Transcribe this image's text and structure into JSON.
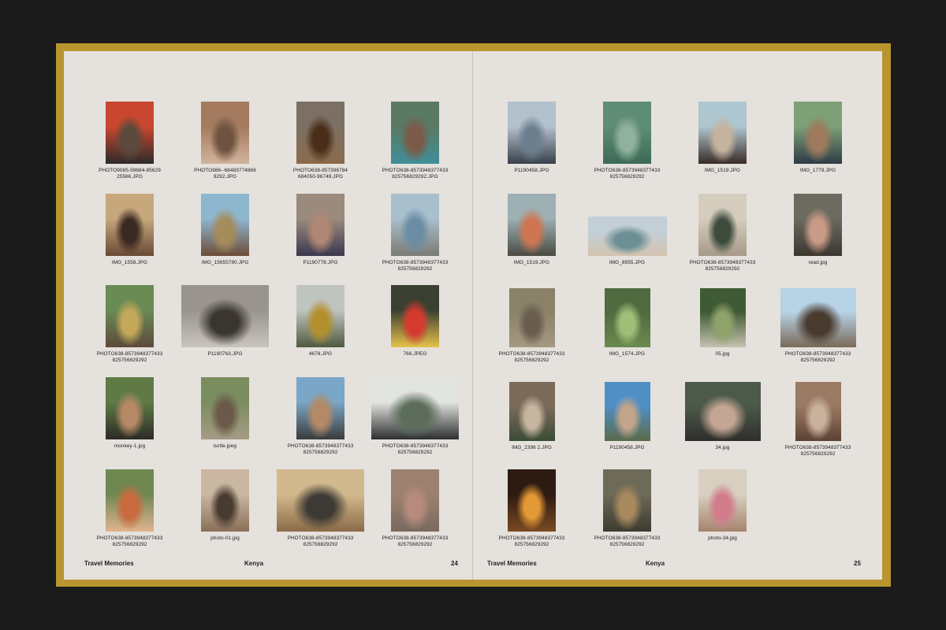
{
  "book": {
    "title": "Travel Memories"
  },
  "pages": [
    {
      "section": "Kenya",
      "number": "24",
      "photos": [
        {
          "caption": "PHOTO9085-59684-85629\n25566.JPG",
          "colors": [
            "#c9472e",
            "#5b4a3d",
            "#2c2b2a"
          ]
        },
        {
          "caption": "PHOTO986--68483774866\n9292.JPG",
          "colors": [
            "#a47b5e",
            "#6f533f",
            "#d1b39b"
          ]
        },
        {
          "caption": "PHOTO638-857396784\n684050-96749.JPG",
          "colors": [
            "#7b7063",
            "#4a2e1a",
            "#8c6a4a"
          ]
        },
        {
          "caption": "PHOTO638-8573948377433\n825756829292.JPG",
          "colors": [
            "#5a7a63",
            "#7a5b49",
            "#3f8f9b"
          ]
        },
        {
          "caption": "IMG_1558.JPG",
          "colors": [
            "#c7a77c",
            "#3b2a22",
            "#6a4a36"
          ]
        },
        {
          "caption": "IMG_15655780.JPG",
          "colors": [
            "#8db6cf",
            "#a68c5b",
            "#6e4b37"
          ]
        },
        {
          "caption": "P1190778.JPG",
          "colors": [
            "#9a8b7d",
            "#b08774",
            "#3a3850"
          ]
        },
        {
          "caption": "PHOTO638-8573948377433\n825756829292",
          "colors": [
            "#a9bfcc",
            "#6a8da3",
            "#7b7a73"
          ]
        },
        {
          "caption": "PHOTO638-8573948377433\n825756829292",
          "colors": [
            "#6a8b54",
            "#c6a85b",
            "#5c4a3c"
          ]
        },
        {
          "caption": "P1190763.JPG",
          "colors": [
            "#9a9490",
            "#3a3530",
            "#c9c4bd"
          ]
        },
        {
          "caption": "4678.JPG",
          "colors": [
            "#bfc4c0",
            "#b3902e",
            "#4e5a3e"
          ]
        },
        {
          "caption": "766.JPEG",
          "colors": [
            "#3a3f31",
            "#d53a2f",
            "#e6c24a"
          ]
        },
        {
          "caption": "monkey-1.jpg",
          "colors": [
            "#5f7a45",
            "#b68966",
            "#2c2a26"
          ]
        },
        {
          "caption": "turtle.jpeg",
          "colors": [
            "#7a8d5e",
            "#6b5a49",
            "#a69b86"
          ]
        },
        {
          "caption": "PHOTO638-8573948377433\n825756829292",
          "colors": [
            "#7aa6c8",
            "#b48a66",
            "#3a3b3a"
          ]
        },
        {
          "caption": "PHOTO638-8573948377433\n825756829292",
          "colors": [
            "#e2e4e1",
            "#5c6e5a",
            "#2d2f2f"
          ]
        },
        {
          "caption": "PHOTO638-8573948377433\n825756829292",
          "colors": [
            "#6f8850",
            "#c96a3f",
            "#e1b38f"
          ]
        },
        {
          "caption": "photo-01.jpg",
          "colors": [
            "#c9b7a1",
            "#4a3b31",
            "#8a6f57"
          ]
        },
        {
          "caption": "PHOTO638-8573948377433\n825756829292",
          "colors": [
            "#d2b98d",
            "#3d3a35",
            "#8b6b48"
          ]
        },
        {
          "caption": "PHOTO638-8573948377433\n825756829292",
          "colors": [
            "#9c8170",
            "#b68a7c",
            "#786a5e"
          ]
        }
      ]
    },
    {
      "section": "Kenya",
      "number": "25",
      "photos": [
        {
          "caption": "P1190458.JPG",
          "colors": [
            "#b3c1cd",
            "#6d7f8f",
            "#39414b"
          ]
        },
        {
          "caption": "PHOTO638-8573948377433\n825756829292",
          "colors": [
            "#5f8c74",
            "#8fb29c",
            "#3c6a57"
          ]
        },
        {
          "caption": "IMG_1519.JPG",
          "colors": [
            "#aec6cf",
            "#c5b39d",
            "#3a2b25"
          ]
        },
        {
          "caption": "IMG_1779.JPG",
          "colors": [
            "#7ea077",
            "#9d7a5c",
            "#2d3b45"
          ]
        },
        {
          "caption": "IMG_1519.JPG",
          "colors": [
            "#9db0b4",
            "#cf7552",
            "#4a4a41"
          ]
        },
        {
          "caption": "IMG_8955.JPG",
          "colors": [
            "#c2cfd6",
            "#6c8f95",
            "#d4c4b0"
          ]
        },
        {
          "caption": "PHOTO638-8573948377433\n825756829292",
          "colors": [
            "#d4ccbd",
            "#3c4b3c",
            "#a69a88"
          ]
        },
        {
          "caption": "read.jpg",
          "colors": [
            "#6b6a5e",
            "#c99a86",
            "#3b3730"
          ]
        },
        {
          "caption": "PHOTO638-8573948377433\n825756829292",
          "colors": [
            "#8a8169",
            "#6a5d4d",
            "#a69882"
          ]
        },
        {
          "caption": "IMG_1574.JPG",
          "colors": [
            "#4f6b3f",
            "#9fbf78",
            "#6a8a4e"
          ]
        },
        {
          "caption": "05.jpg",
          "colors": [
            "#3f5b35",
            "#8fa26a",
            "#c7c2b0"
          ]
        },
        {
          "caption": "PHOTO638-8573948377433\n825756829292",
          "colors": [
            "#b7d3e6",
            "#4a3b2f",
            "#7a6a57"
          ]
        },
        {
          "caption": "IMG_2396 2.JPG",
          "colors": [
            "#7c6a5a",
            "#c6b59f",
            "#3a4c36"
          ]
        },
        {
          "caption": "P1190458.JPG",
          "colors": [
            "#4f8fc6",
            "#c2a58a",
            "#5a6b4a"
          ]
        },
        {
          "caption": "34.jpg",
          "colors": [
            "#4c5a4a",
            "#c4a694",
            "#2f2e2c"
          ]
        },
        {
          "caption": "PHOTO638-8573948377433\n825756829292",
          "colors": [
            "#9b7a63",
            "#c9b19c",
            "#5c4234"
          ]
        },
        {
          "caption": "PHOTO638-8573948377433\n825756829292",
          "colors": [
            "#2d1a10",
            "#e39a36",
            "#7a4a22"
          ]
        },
        {
          "caption": "PHOTO638-8573948377433\n825756829292",
          "colors": [
            "#6d6a58",
            "#a88a5e",
            "#3e3b30"
          ]
        },
        {
          "caption": "photo-34.jpg",
          "colors": [
            "#d8cfc0",
            "#d27b8a",
            "#a6846e"
          ]
        }
      ]
    }
  ]
}
